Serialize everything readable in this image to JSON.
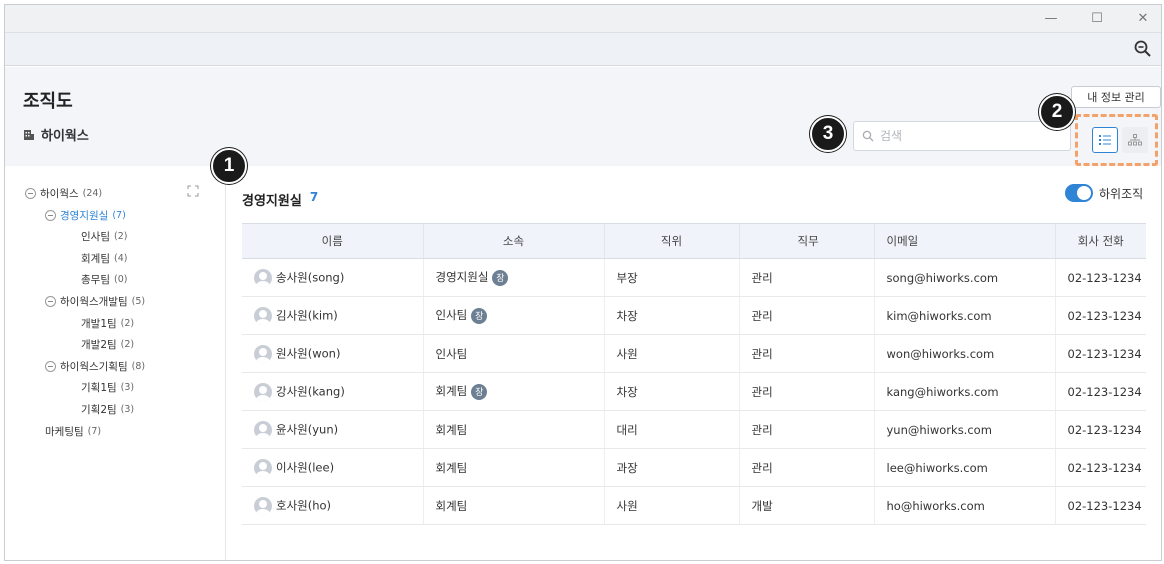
{
  "window": {
    "minimize": "—",
    "maximize": "☐",
    "close": "✕"
  },
  "header": {
    "title": "조직도",
    "company": "하이웍스",
    "my_info_button": "내 정보 관리"
  },
  "search": {
    "placeholder": "검색"
  },
  "badges": [
    "1",
    "2",
    "3"
  ],
  "accent_color": "#2f84d6",
  "highlight_color": "#f4a26b",
  "tree": [
    {
      "label": "하이웍스",
      "count": "(24)",
      "level": 0,
      "collapsible": true,
      "active": false
    },
    {
      "label": "경영지원실",
      "count": "(7)",
      "level": 1,
      "collapsible": true,
      "active": true
    },
    {
      "label": "인사팀",
      "count": "(2)",
      "level": 2,
      "collapsible": false,
      "active": false
    },
    {
      "label": "회계팀",
      "count": "(4)",
      "level": 2,
      "collapsible": false,
      "active": false
    },
    {
      "label": "총무팀",
      "count": "(0)",
      "level": 2,
      "collapsible": false,
      "active": false
    },
    {
      "label": "하이웍스개발팀",
      "count": "(5)",
      "level": 1,
      "collapsible": true,
      "active": false
    },
    {
      "label": "개발1팀",
      "count": "(2)",
      "level": 2,
      "collapsible": false,
      "active": false
    },
    {
      "label": "개발2팀",
      "count": "(2)",
      "level": 2,
      "collapsible": false,
      "active": false
    },
    {
      "label": "하이웍스기획팀",
      "count": "(8)",
      "level": 1,
      "collapsible": true,
      "active": false
    },
    {
      "label": "기획1팀",
      "count": "(3)",
      "level": 2,
      "collapsible": false,
      "active": false
    },
    {
      "label": "기획2팀",
      "count": "(3)",
      "level": 2,
      "collapsible": false,
      "active": false
    },
    {
      "label": "마케팅팀",
      "count": "(7)",
      "level": 1,
      "collapsible": false,
      "active": false
    }
  ],
  "content": {
    "dept_name": "경영지원실",
    "dept_count": "7",
    "subdept_toggle_label": "하위조직",
    "subdept_toggle_on": true
  },
  "table": {
    "columns": [
      "이름",
      "소속",
      "직위",
      "직무",
      "이메일",
      "회사 전화"
    ],
    "chief_mark": "장",
    "rows": [
      {
        "name": "송사원(song)",
        "dept": "경영지원실",
        "chief": true,
        "position": "부장",
        "duty": "관리",
        "email": "song@hiworks.com",
        "phone": "02-123-1234"
      },
      {
        "name": "김사원(kim)",
        "dept": "인사팀",
        "chief": true,
        "position": "차장",
        "duty": "관리",
        "email": "kim@hiworks.com",
        "phone": "02-123-1234"
      },
      {
        "name": "원사원(won)",
        "dept": "인사팀",
        "chief": false,
        "position": "사원",
        "duty": "관리",
        "email": "won@hiworks.com",
        "phone": "02-123-1234"
      },
      {
        "name": "강사원(kang)",
        "dept": "회계팀",
        "chief": true,
        "position": "차장",
        "duty": "관리",
        "email": "kang@hiworks.com",
        "phone": "02-123-1234"
      },
      {
        "name": "윤사원(yun)",
        "dept": "회계팀",
        "chief": false,
        "position": "대리",
        "duty": "관리",
        "email": "yun@hiworks.com",
        "phone": "02-123-1234"
      },
      {
        "name": "이사원(lee)",
        "dept": "회계팀",
        "chief": false,
        "position": "과장",
        "duty": "관리",
        "email": "lee@hiworks.com",
        "phone": "02-123-1234"
      },
      {
        "name": "호사원(ho)",
        "dept": "회계팀",
        "chief": false,
        "position": "사원",
        "duty": "개발",
        "email": "ho@hiworks.com",
        "phone": "02-123-1234"
      }
    ]
  }
}
